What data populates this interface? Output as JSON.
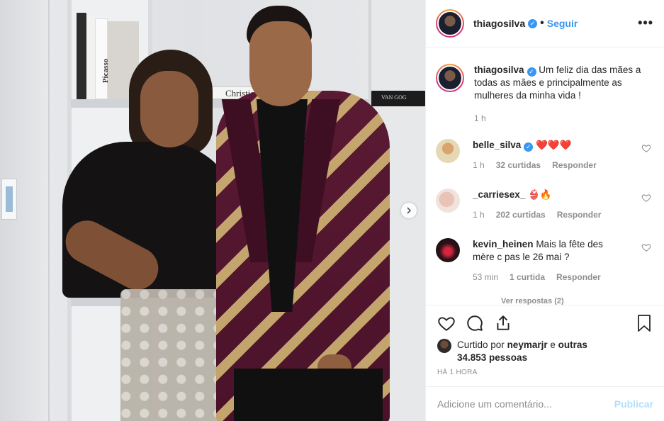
{
  "header": {
    "username": "thiagosilva",
    "separator": "•",
    "follow_label": "Seguir",
    "more_label": "•••"
  },
  "caption": {
    "username": "thiagosilva",
    "text": "Um feliz dia das mães a todas as mães e principalmente as mulheres da minha vida !",
    "time": "1 h"
  },
  "comments": [
    {
      "username": "belle_silva",
      "verified": true,
      "text": "❤️❤️❤️",
      "time": "1 h",
      "likes": "32 curtidas",
      "reply": "Responder"
    },
    {
      "username": "_carriesex_",
      "verified": false,
      "text": "👙🔥",
      "time": "1 h",
      "likes": "202 curtidas",
      "reply": "Responder"
    },
    {
      "username": "kevin_heinen",
      "verified": false,
      "text": "Mais la fête des mère c pas le 26 mai ?",
      "time": "53 min",
      "likes": "1 curtida",
      "reply": "Responder"
    }
  ],
  "view_replies": "Ver respostas (2)",
  "photo": {
    "book_titles": [
      "Picasso",
      "Christian",
      "VAN GOG"
    ]
  },
  "likes": {
    "prefix": "Curtido por",
    "user": "neymarjr",
    "suffix": "e",
    "others": "outras 34.853 pessoas"
  },
  "timestamp": "HÁ 1 HORA",
  "add_comment": {
    "placeholder": "Adicione um comentário...",
    "publish_label": "Publicar"
  },
  "icons": {
    "like": "heart-icon",
    "comment": "comment-icon",
    "share": "share-icon",
    "save": "bookmark-icon",
    "next": "chevron-right-icon"
  }
}
